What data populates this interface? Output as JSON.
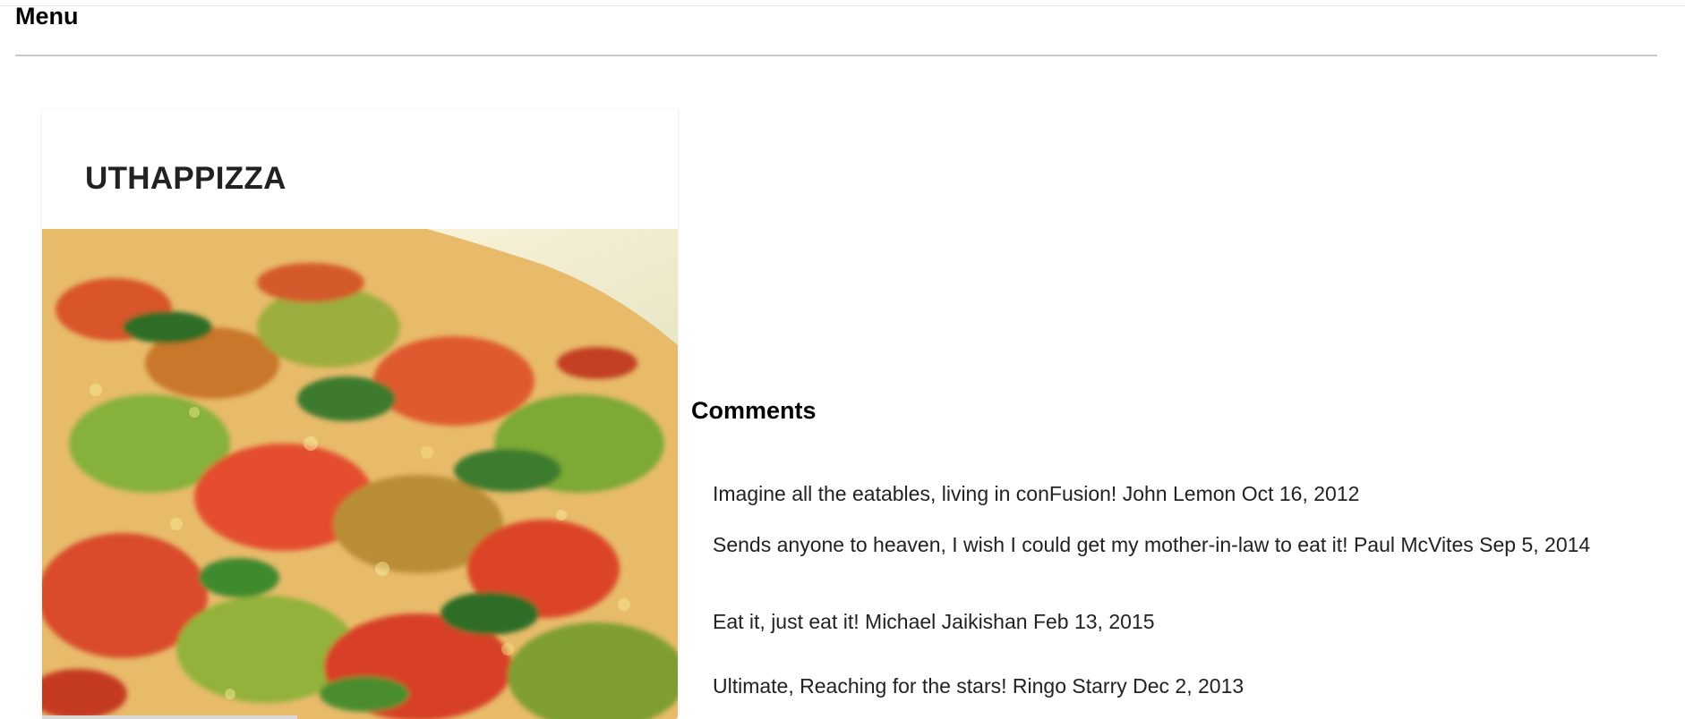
{
  "header": {
    "title": "Menu"
  },
  "dish": {
    "name": "UTHAPPIZZA",
    "image_description_icon": "pizza-photo"
  },
  "comments": {
    "heading": "Comments",
    "items": [
      {
        "text": "Imagine all the eatables, living in conFusion!",
        "author": "John Lemon",
        "date": "Oct 16, 2012"
      },
      {
        "text": "Sends anyone to heaven, I wish I could get my mother-in-law to eat it!",
        "author": "Paul McVites",
        "date": "Sep 5, 2014"
      },
      {
        "text": "Eat it, just eat it!",
        "author": "Michael Jaikishan",
        "date": "Feb 13, 2015"
      },
      {
        "text": "Ultimate, Reaching for the stars!",
        "author": "Ringo Starry",
        "date": "Dec 2, 2013"
      }
    ]
  },
  "colors": {
    "text": "#222222",
    "divider": "#c8c8c8",
    "background": "#ffffff"
  }
}
